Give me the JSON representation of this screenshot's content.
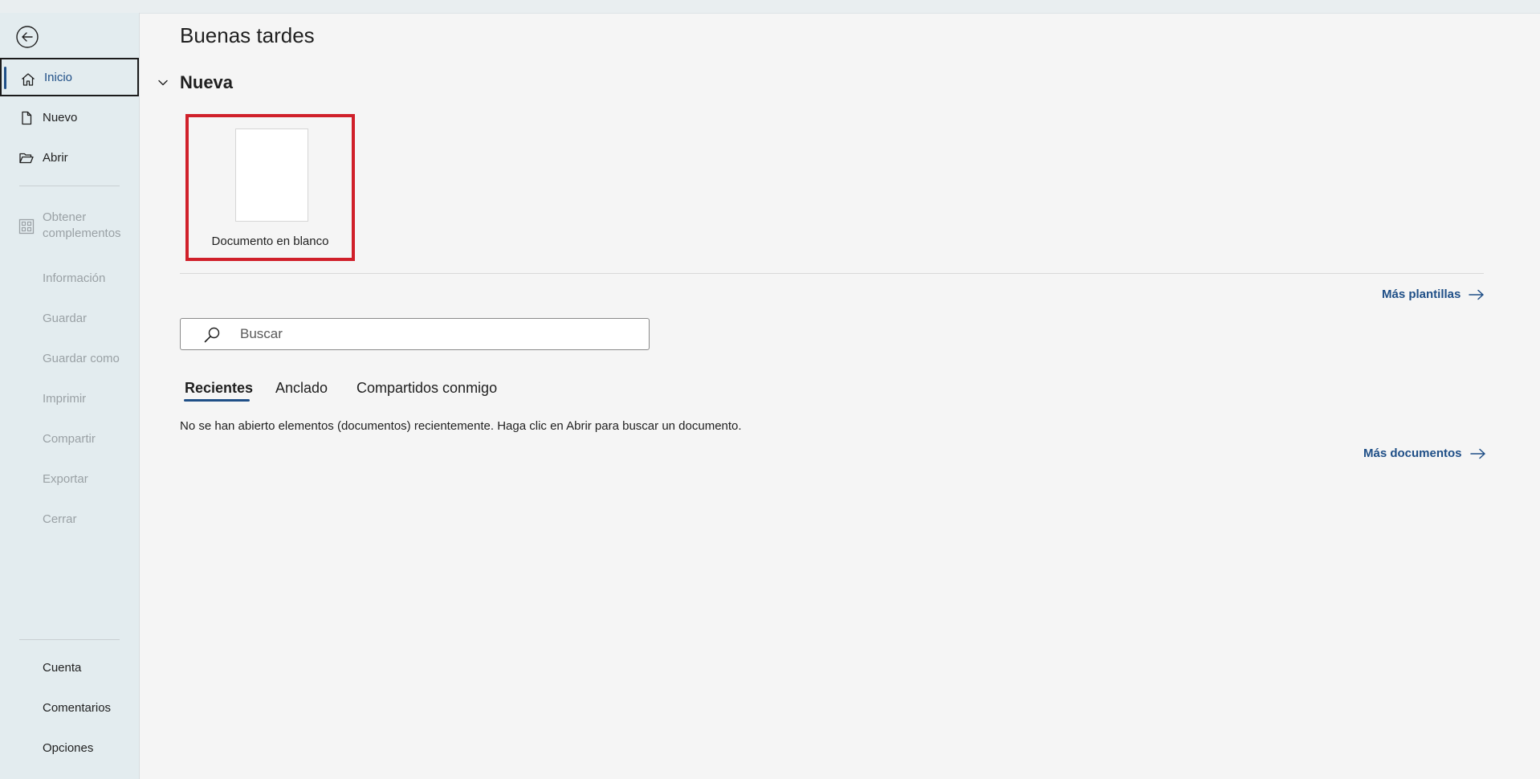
{
  "greeting": "Buenas tardes",
  "section": {
    "title": "Nueva",
    "templates": [
      {
        "label": "Documento en blanco"
      }
    ],
    "more_templates": "Más plantillas"
  },
  "sidebar": {
    "back_icon": "back-arrow-icon",
    "items": [
      {
        "label": "Inicio",
        "icon": "home-icon",
        "state": "active"
      },
      {
        "label": "Nuevo",
        "icon": "new-document-icon",
        "state": "enabled"
      },
      {
        "label": "Abrir",
        "icon": "folder-open-icon",
        "state": "enabled"
      },
      {
        "label": "Obtener complementos",
        "icon": "add-ins-grid-icon",
        "state": "disabled"
      },
      {
        "label": "Información",
        "state": "disabled"
      },
      {
        "label": "Guardar",
        "state": "disabled"
      },
      {
        "label": "Guardar como",
        "state": "disabled"
      },
      {
        "label": "Imprimir",
        "state": "disabled"
      },
      {
        "label": "Compartir",
        "state": "disabled"
      },
      {
        "label": "Exportar",
        "state": "disabled"
      },
      {
        "label": "Cerrar",
        "state": "disabled"
      }
    ],
    "bottom_items": [
      {
        "label": "Cuenta"
      },
      {
        "label": "Comentarios"
      },
      {
        "label": "Opciones"
      }
    ]
  },
  "search": {
    "placeholder": "Buscar",
    "value": ""
  },
  "tabs": [
    {
      "label": "Recientes",
      "active": true
    },
    {
      "label": "Anclado",
      "active": false
    },
    {
      "label": "Compartidos conmigo",
      "active": false
    }
  ],
  "recent": {
    "empty_message": "No se han abierto elementos (documentos) recientemente. Haga clic en Abrir para buscar un documento.",
    "more_documents": "Más documentos"
  },
  "colors": {
    "accent": "#1f4f87",
    "highlight_border": "#d0202a",
    "sidebar_bg": "#e3ecef",
    "main_bg": "#f5f5f5",
    "disabled_text": "#9aa1a5"
  }
}
